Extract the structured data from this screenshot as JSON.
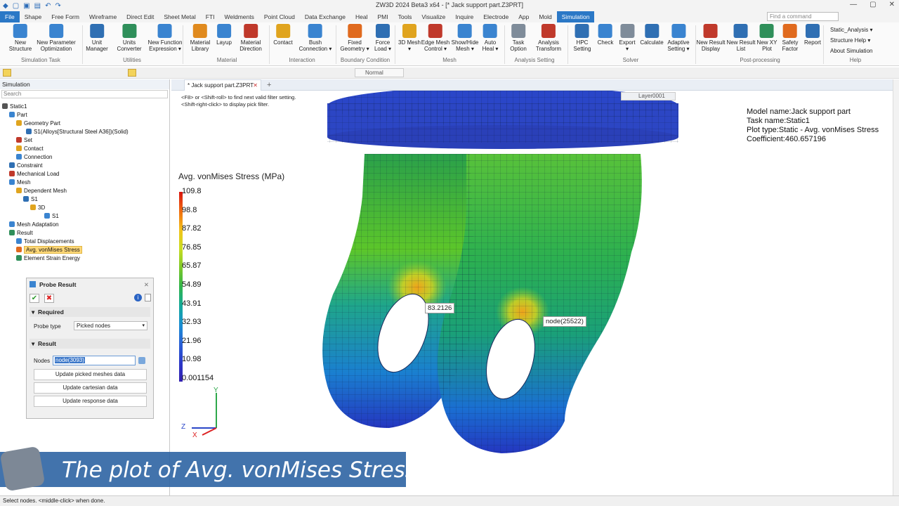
{
  "app": {
    "title": "ZW3D 2024 Beta3 x64 - [* Jack support part.Z3PRT]",
    "search_placeholder": "Find a command"
  },
  "menu": [
    "File",
    "Shape",
    "Free Form",
    "Wireframe",
    "Direct Edit",
    "Sheet Metal",
    "FTI",
    "Weldments",
    "Point Cloud",
    "Data Exchange",
    "Heal",
    "PMI",
    "Tools",
    "Visualize",
    "Inquire",
    "Electrode",
    "App",
    "Mold",
    "Simulation"
  ],
  "ribbon": {
    "buttons": [
      {
        "l1": "New",
        "l2": "Structure",
        "color": "#3a84d0"
      },
      {
        "l1": "New Parameter",
        "l2": "Optimization",
        "color": "#3a84d0"
      },
      {
        "l1": "Unit",
        "l2": "Manager",
        "color": "#2f6fb3"
      },
      {
        "l1": "Units",
        "l2": "Converter",
        "color": "#2f8f5a"
      },
      {
        "l1": "New Function",
        "l2": "Expression ▾",
        "color": "#3a84d0"
      },
      {
        "l1": "Material",
        "l2": "Library",
        "color": "#e08a1e"
      },
      {
        "l1": "Layup",
        "l2": "",
        "color": "#3a84d0"
      },
      {
        "l1": "Material",
        "l2": "Direction",
        "color": "#c0392b"
      },
      {
        "l1": "Contact",
        "l2": "",
        "color": "#e0a41e"
      },
      {
        "l1": "Bush",
        "l2": "Connection ▾",
        "color": "#3a84d0"
      },
      {
        "l1": "Fixed",
        "l2": "Geometry ▾",
        "color": "#e06a1e"
      },
      {
        "l1": "Force",
        "l2": "Load ▾",
        "color": "#2f6fb3"
      },
      {
        "l1": "3D Mesh",
        "l2": "▾",
        "color": "#e0a41e"
      },
      {
        "l1": "Edge Mesh",
        "l2": "Control ▾",
        "color": "#c0392b"
      },
      {
        "l1": "Show/Hide",
        "l2": "Mesh ▾",
        "color": "#3a84d0"
      },
      {
        "l1": "Auto",
        "l2": "Heal ▾",
        "color": "#3a84d0"
      },
      {
        "l1": "Task",
        "l2": "Option",
        "color": "#7f8c9a"
      },
      {
        "l1": "Analysis",
        "l2": "Transform",
        "color": "#c0392b"
      },
      {
        "l1": "HPC",
        "l2": "Setting",
        "color": "#2f6fb3"
      },
      {
        "l1": "Check",
        "l2": "",
        "color": "#3a84d0"
      },
      {
        "l1": "Export",
        "l2": "▾",
        "color": "#7f8c9a"
      },
      {
        "l1": "Calculate",
        "l2": "",
        "color": "#2f6fb3"
      },
      {
        "l1": "Adaptive",
        "l2": "Setting ▾",
        "color": "#3a84d0"
      },
      {
        "l1": "New Result",
        "l2": "Display",
        "color": "#c0392b"
      },
      {
        "l1": "New Result",
        "l2": "List",
        "color": "#2f6fb3"
      },
      {
        "l1": "New XY",
        "l2": "Plot",
        "color": "#2f8f5a"
      },
      {
        "l1": "Safety",
        "l2": "Factor",
        "color": "#e06a1e"
      },
      {
        "l1": "Report",
        "l2": "",
        "color": "#2f6fb3"
      }
    ],
    "groups": [
      "Simulation Task",
      "Utilities",
      "Material",
      "Interaction",
      "Boundary Condition",
      "Mesh",
      "Analysis Setting",
      "Solver",
      "Post-processing",
      "Help"
    ],
    "help_items": [
      "Static_Analysis ▾",
      "Structure Help ▾",
      "About Simulation"
    ]
  },
  "toolbar2": {
    "mode_value": "Normal"
  },
  "panel": {
    "title": "Simulation",
    "search_placeholder": "Search",
    "tree": [
      "Static1",
      "Part",
      "Geometry Part",
      "S1(Alloys[Structural Steel A36])(Solid)",
      "Set",
      "Contact",
      "Connection",
      "Constraint",
      "Mechanical Load",
      "Mesh",
      "Dependent Mesh",
      "S1",
      "3D",
      "S1",
      "Mesh Adaptation",
      "Result",
      "Total Displacements",
      "Avg. vonMises Stress",
      "Element Strain Energy"
    ]
  },
  "probe": {
    "title": "Probe Result",
    "required_label": "Required",
    "probe_type_label": "Probe type",
    "probe_type_value": "Picked nodes",
    "result_label": "Result",
    "nodes_label": "Nodes",
    "nodes_value": "node(3093)",
    "btn1": "Update picked meshes data",
    "btn2": "Update cartesian data",
    "btn3": "Update response data"
  },
  "doc_tab": "* Jack support part.Z3PRT",
  "viewport": {
    "hint1": "<F8> or <Shift-roll> to find next valid filter setting.",
    "hint2": "<Shift-right-click> to display pick filter.",
    "layer": "Layer0001",
    "info": [
      "Model name:Jack support part",
      "Task name:Static1",
      "Plot type:Static - Avg. vonMises Stress",
      "Coefficient:460.657196"
    ],
    "legend_title": "Avg. vonMises Stress (MPa)",
    "legend_ticks": [
      "109.8",
      "98.8",
      "87.82",
      "76.85",
      "65.87",
      "54.89",
      "43.91",
      "32.93",
      "21.96",
      "10.98",
      "0.001154"
    ],
    "probe_label_1": "83.2126",
    "probe_label_2": "node(25522)",
    "axis_y": "Y",
    "axis_z": "Z",
    "axis_x": "X"
  },
  "banner": "The plot of Avg. vonMises Stress",
  "status": "Select nodes. <middle-click> when done."
}
